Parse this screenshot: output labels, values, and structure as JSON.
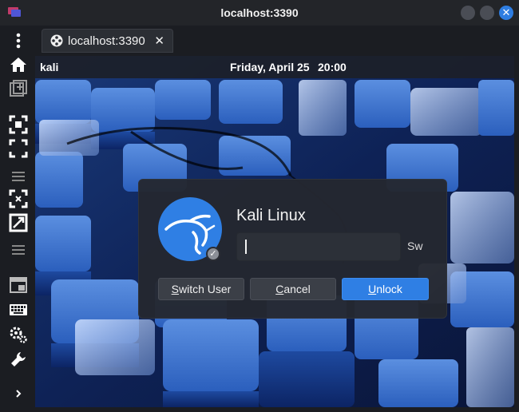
{
  "window": {
    "title": "localhost:3390"
  },
  "tab": {
    "label": "localhost:3390",
    "close_glyph": "✕"
  },
  "sidebar": {
    "items": [
      {
        "icon": "kebab-menu-icon"
      },
      {
        "icon": "home-icon"
      },
      {
        "icon": "new-window-icon"
      },
      {
        "icon": "fit-screen-icon"
      },
      {
        "icon": "fullscreen-icon"
      },
      {
        "icon": "separator-lines-icon"
      },
      {
        "icon": "scale-down-icon"
      },
      {
        "icon": "scale-up-icon"
      },
      {
        "icon": "separator-lines-icon"
      },
      {
        "icon": "display-icon"
      },
      {
        "icon": "keyboard-icon"
      },
      {
        "icon": "settings-gears-icon"
      },
      {
        "icon": "wrench-icon"
      },
      {
        "icon": "expand-arrow-icon"
      }
    ]
  },
  "remote": {
    "topbar": {
      "user": "kali",
      "date": "Friday, April 25",
      "time": "20:00"
    },
    "lock_dialog": {
      "username": "Kali Linux",
      "password_value": "",
      "switch_label_truncated": "Sw",
      "buttons": {
        "switch_user_first": "S",
        "switch_user_rest": "witch User",
        "cancel_first": "C",
        "cancel_rest": "ancel",
        "unlock_first": "U",
        "unlock_rest": "nlock"
      }
    }
  },
  "colors": {
    "accent": "#2f7fe4",
    "titlebar": "#232529",
    "toolbar": "#1b1d22",
    "dialog": "#24282f"
  }
}
